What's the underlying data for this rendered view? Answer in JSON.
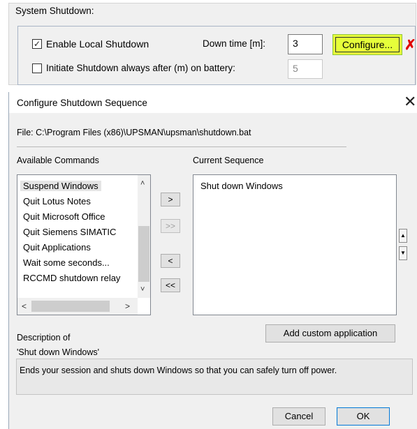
{
  "system_shutdown": {
    "title": "System Shutdown:",
    "enable_local_label": "Enable Local Shutdown",
    "enable_local_checked": true,
    "down_time_label": "Down time [m]:",
    "down_time_value": "3",
    "configure_label": "Configure...",
    "initiate_label": "Initiate Shutdown always after (m) on battery:",
    "initiate_checked": false,
    "initiate_value": "5",
    "highlight_color": "#e6ff3a",
    "annotation_color": "#e00000"
  },
  "dialog": {
    "title": "Configure Shutdown Sequence",
    "file_path": "File: C:\\Program Files (x86)\\UPSMAN\\upsman\\shutdown.bat",
    "available_label": "Available Commands",
    "current_label": "Current Sequence",
    "available_commands": [
      "Suspend Windows",
      "Quit Lotus Notes",
      "Quit Microsoft Office",
      "Quit Siemens SIMATIC",
      "Quit Applications",
      "Wait some seconds...",
      "RCCMD shutdown relay"
    ],
    "current_sequence": [
      "Shut down Windows"
    ],
    "add_button": ">",
    "add_all_button": ">>",
    "remove_button": "<",
    "remove_all_button": "<<",
    "add_custom_label": "Add custom application",
    "description_heading": "Description of",
    "description_item": "'Shut down Windows'",
    "description_text": "Ends your session and shuts down Windows so that you can safely turn off power.",
    "cancel_label": "Cancel",
    "ok_label": "OK"
  },
  "icons": {
    "checkmark": "✓",
    "close": "✕",
    "red_cross": "✗"
  }
}
